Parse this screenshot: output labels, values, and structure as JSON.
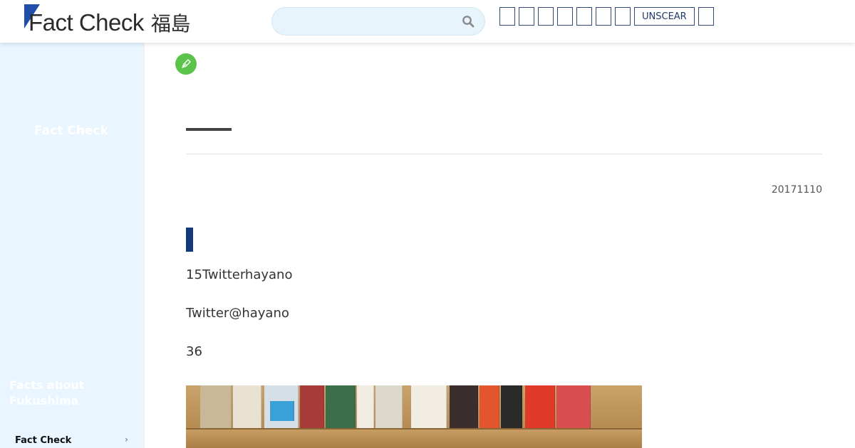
{
  "header": {
    "logo_text": "Fact Check",
    "logo_kanji": "福島",
    "search_placeholder": "",
    "nav_button_label": "UNSCEAR"
  },
  "sidebar": {
    "title": "Fact Check",
    "facts_heading": "Facts about Fukushima",
    "item_label": "Fact Check",
    "chevron": "›"
  },
  "article": {
    "date": "20171110",
    "paragraphs": [
      "15Twitterhayano",
      "Twitter@hayano",
      "36"
    ]
  },
  "colors": {
    "brand_blue": "#1f4fa8",
    "badge_green": "#5bc24a",
    "section_mark": "#123a7a",
    "sidebar_bg": "#e9f6ff"
  }
}
